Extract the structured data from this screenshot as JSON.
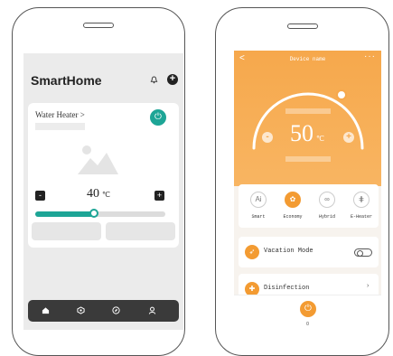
{
  "left_phone": {
    "app_title": "SmartHome",
    "header_icons": {
      "bell": "bell-icon",
      "add": "plus-icon"
    },
    "device_card": {
      "name": "Water Heater >",
      "power_icon": "power-icon",
      "temperature": "40",
      "unit": "℃",
      "minus_label": "-",
      "plus_label": "+",
      "slider_level_percent": 45
    },
    "bottom_nav": [
      "home-icon",
      "devices-icon",
      "discover-icon",
      "profile-icon"
    ]
  },
  "right_phone": {
    "device_title": "Device name",
    "back_glyph": "<",
    "more_glyph": "···",
    "temperature": "50",
    "unit": "℃",
    "minus_label": "-",
    "plus_label": "+",
    "modes": [
      {
        "label": "Smart",
        "icon": "ai-icon",
        "active": false
      },
      {
        "label": "Economy",
        "icon": "leaf-icon",
        "active": true
      },
      {
        "label": "Hybrid",
        "icon": "infinity-icon",
        "active": false
      },
      {
        "label": "E-Heater",
        "icon": "heater-icon",
        "active": false
      }
    ],
    "rows": [
      {
        "label": "Vacation Mode",
        "control": "toggle"
      },
      {
        "label": "Disinfection",
        "control": "chevron"
      }
    ],
    "bottom_value": "0",
    "accent_color": "#f39b32"
  },
  "teal_color": "#1da596"
}
